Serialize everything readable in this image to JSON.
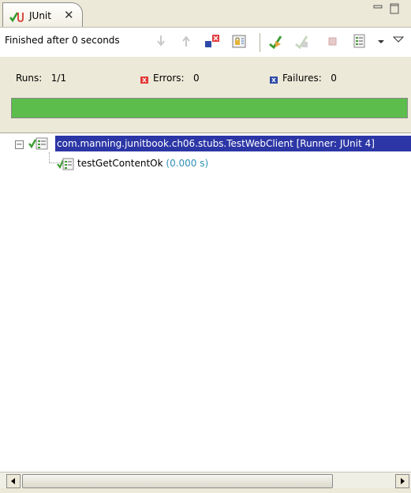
{
  "tab": {
    "title": "JUnit",
    "close_glyph": "✕",
    "icon": "junit-icon"
  },
  "toolbar": {
    "status": "Finished after 0 seconds",
    "buttons": [
      "next-failure-icon",
      "previous-failure-icon",
      "failures-only-icon",
      "scroll-lock-icon",
      "rerun-icon",
      "rerun-failed-icon",
      "stop-icon",
      "test-run-history-icon",
      "history-dropdown-icon",
      "view-menu-icon"
    ]
  },
  "counters": {
    "runs_label": "Runs:",
    "runs_value": "1/1",
    "errors_label": "Errors:",
    "errors_value": "0",
    "failures_label": "Failures:",
    "failures_value": "0",
    "progress": 1.0,
    "colors": {
      "progress_ok": "#5cbc4c",
      "error_marker": "#e33b3b",
      "failure_marker": "#2e4aa8"
    }
  },
  "tree": {
    "suite": {
      "label": "com.manning.junitbook.ch06.stubs.TestWebClient [Runner: JUnit 4]",
      "expander": "−",
      "selected_bg": "#2c36a6"
    },
    "tests": [
      {
        "name": "testGetContentOk",
        "time": "(0.000 s)"
      }
    ]
  },
  "scrollbar": {
    "left_arrow": "◀",
    "right_arrow": "▶"
  }
}
